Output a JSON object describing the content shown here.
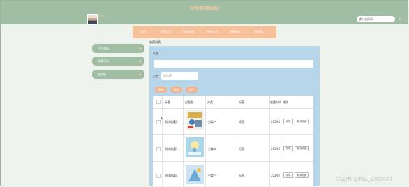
{
  "site_title": "华阳科普网站",
  "user": {
    "name": "小明"
  },
  "search": {
    "placeholder": "输入关键词"
  },
  "nav": [
    "首页",
    "资源信息",
    "科研成果",
    "系统公告",
    "科普资料",
    "留言板"
  ],
  "sidebar": [
    {
      "label": "个人资料"
    },
    {
      "label": "收藏列表"
    },
    {
      "label": "留言板"
    }
  ],
  "breadcrumb": "收藏列表",
  "filters": {
    "title_label": "标题",
    "category_label": "分类",
    "category_placeholder": "请选择"
  },
  "buttons": {
    "search": "查询",
    "delete": "删除",
    "clear": "清空"
  },
  "table": {
    "headers": [
      "标题",
      "封面图",
      "分类",
      "标签",
      "收藏时间",
      "操作"
    ],
    "rows": [
      {
        "title": "测试收藏2",
        "category": "分类一",
        "tag": "标签",
        "time": "2024-0",
        "view": "详情",
        "cancel": "取消收藏"
      },
      {
        "title": "测试收藏1",
        "category": "分类二",
        "tag": "标签",
        "time": "2024-0",
        "view": "详情",
        "cancel": "取消收藏"
      },
      {
        "title": "测试收藏4",
        "category": "分类三",
        "tag": "标签",
        "time": "2024-0",
        "view": "详情",
        "cancel": "取消收藏"
      }
    ]
  },
  "watermark": "CSDN @MZ_ZXD001",
  "colors": {
    "header": "#9fbea4",
    "nav": "#f5c09a",
    "panel": "#b8d6ea",
    "button": "#f3b38e"
  }
}
